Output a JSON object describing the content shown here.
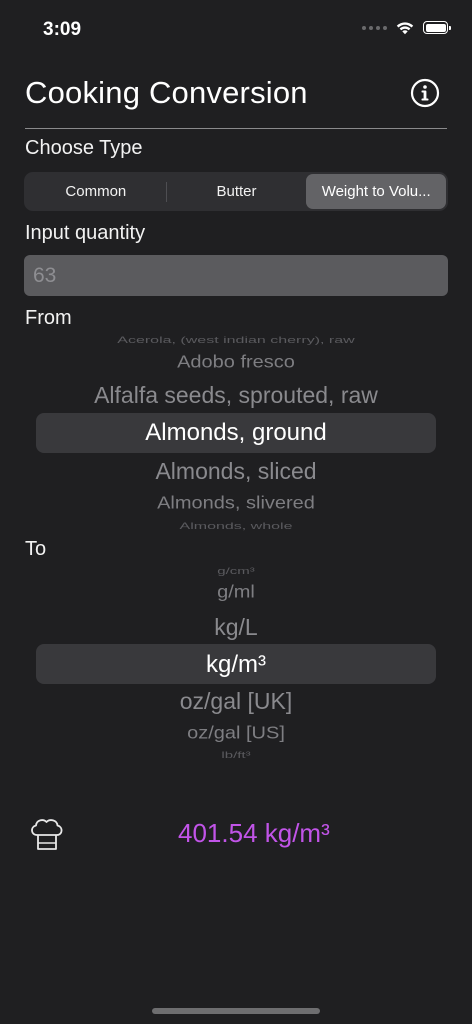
{
  "status_bar": {
    "time": "3:09",
    "icons": [
      "cellular-dots-icon",
      "wifi-icon",
      "battery-icon"
    ]
  },
  "header": {
    "title": "Cooking Conversion",
    "info_icon": "info-circle-icon"
  },
  "type_section": {
    "label": "Choose Type",
    "segments": [
      {
        "label": "Common",
        "selected": false
      },
      {
        "label": "Butter",
        "selected": false
      },
      {
        "label": "Weight to Volu...",
        "selected": true
      }
    ]
  },
  "quantity": {
    "label": "Input quantity",
    "placeholder": "63",
    "value": ""
  },
  "from": {
    "label": "From",
    "options": [
      "Acerola, (west indian cherry), raw",
      "Adobo fresco",
      "Alfalfa seeds, sprouted, raw",
      "Almonds, ground",
      "Almonds, sliced",
      "Almonds, slivered",
      "Almonds, whole"
    ],
    "selected": "Almonds, ground"
  },
  "to": {
    "label": "To",
    "options": [
      "g/cm³",
      "g/ml",
      "kg/L",
      "kg/m³",
      "oz/gal [UK]",
      "oz/gal [US]",
      "lb/ft³"
    ],
    "selected": "kg/m³"
  },
  "result": {
    "text": "401.54 kg/m³",
    "icon": "chef-hat-icon"
  },
  "colors": {
    "background": "#1f1f21",
    "accent": "#c154e8",
    "field": "#5b5b5e",
    "selected_segment": "#636366"
  }
}
